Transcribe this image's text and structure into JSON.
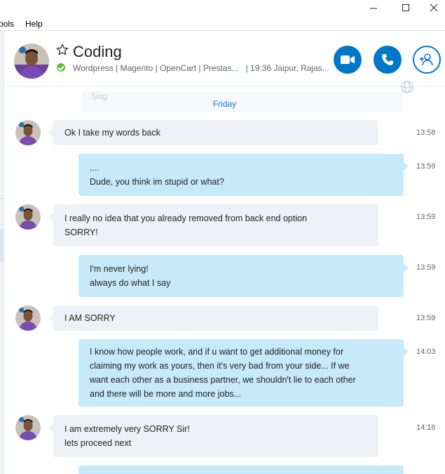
{
  "menu": {
    "tools": "ools",
    "help": "Help"
  },
  "window_controls": [
    "minimize-icon",
    "maximize-icon",
    "close-icon"
  ],
  "contact": {
    "name": "Coding",
    "mood": "Wordpress | Magento | OpenCart | Prestas...",
    "location": "| 19:36 Jaipur, Rajas..."
  },
  "colors": {
    "accent": "#0078ca",
    "incoming": "#eef1f6",
    "outgoing": "#c7eafb",
    "online": "#5fbb32"
  },
  "conversation": {
    "faded_label": "Sisg",
    "day_separator": "Friday",
    "messages": [
      {
        "direction": "in",
        "lines": [
          "Ok I take my words back"
        ],
        "time": "13:58"
      },
      {
        "direction": "out",
        "lines": [
          "....",
          "Dude, you think im stupid or what?"
        ],
        "time": "13:59"
      },
      {
        "direction": "in",
        "lines": [
          "I really no idea that you already removed from back end option",
          "SORRY!"
        ],
        "time": "13:59"
      },
      {
        "direction": "out",
        "lines": [
          "I'm never lying!",
          "always do what I say"
        ],
        "time": "13:59"
      },
      {
        "direction": "in",
        "lines": [
          "I AM SORRY"
        ],
        "time": "13:59"
      },
      {
        "direction": "out",
        "lines": [
          "I know how people work, and if u want to get additional money for",
          "claiming my work as yours, then it's very bad from your side... If we",
          "want each other as a business partner, we shouldn't lie to each other",
          "and there will be more and more jobs..."
        ],
        "time": "14:03"
      },
      {
        "direction": "in",
        "lines": [
          "I am extremely very SORRY Sir!",
          "lets proceed next"
        ],
        "time": "14:16"
      }
    ]
  }
}
